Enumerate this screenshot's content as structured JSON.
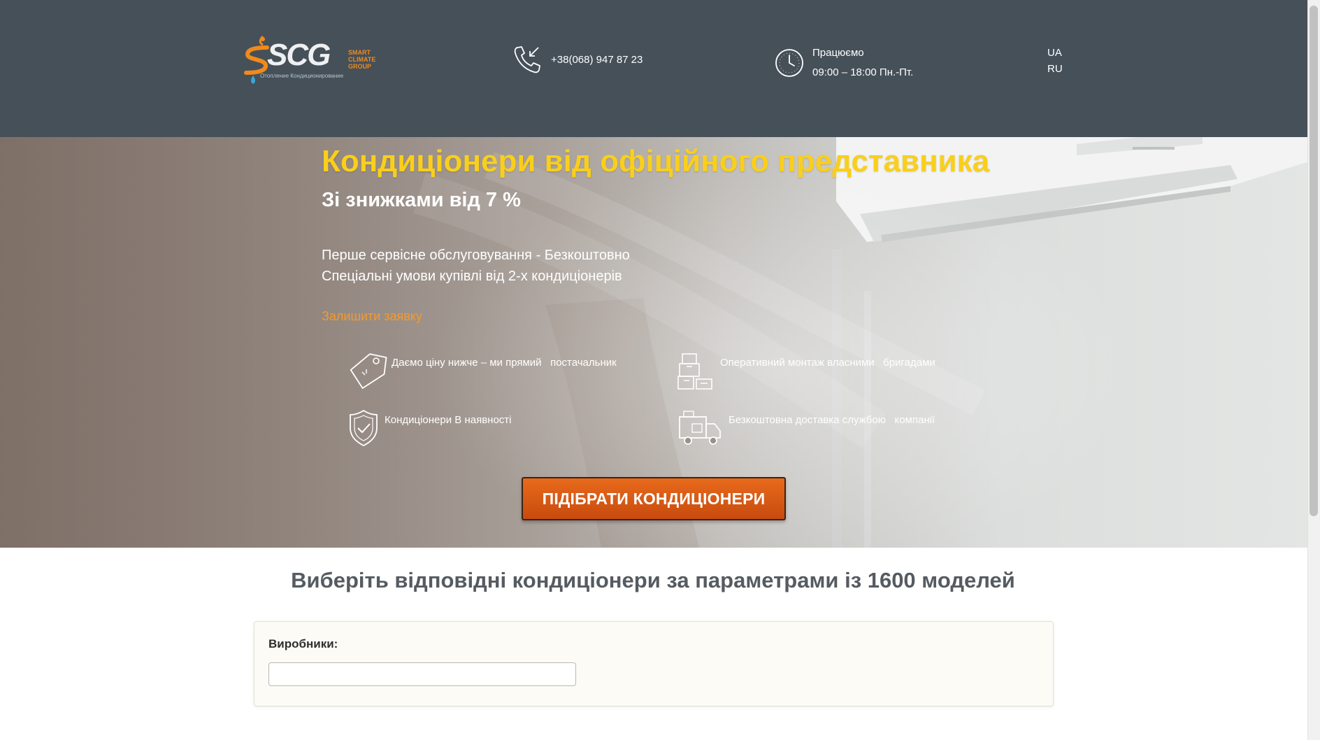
{
  "header": {
    "logo": {
      "brand": "SCG",
      "tagline": [
        "SMART",
        "CLIMATE",
        "GROUP"
      ],
      "subtitle": "Отопление Кондиционирование"
    },
    "phone": "+38(068) 947 87 23",
    "hours": {
      "label": "Працюємо",
      "time": "09:00 – 18:00 Пн.-Пт."
    },
    "languages": [
      "UA",
      "RU"
    ]
  },
  "hero": {
    "title": "Кондиціонери від офіційного представника",
    "subtitle": "Зі знижками від 7 %",
    "lines": [
      "Перше сервісне обслуговування - Безкоштовно",
      "Спеціальні умови купівлі від 2-х кондиціонерів"
    ],
    "link": "Залишити заявку",
    "features": [
      {
        "icon": "price-tag-icon",
        "text": "Даємо ціну нижче – ми прямий   постачальник"
      },
      {
        "icon": "boxes-icon",
        "text": "Оперативний монтаж власними   бригадами"
      },
      {
        "icon": "shield-check-icon",
        "text": "Кондиціонери В наявності"
      },
      {
        "icon": "delivery-truck-icon",
        "text": "Безкоштовна доставка службою   компанії"
      }
    ],
    "cta": "ПІДІБРАТИ КОНДИЦІОНЕРИ"
  },
  "filter": {
    "heading": "Виберіть відповідні кондиціонери за параметрами із 1600 моделей",
    "label": "Виробники:",
    "input_value": ""
  },
  "colors": {
    "header_bg": "#465059",
    "accent_yellow": "#f9cf1c",
    "accent_orange": "#e86a1c",
    "link_orange": "#f39a2e"
  }
}
